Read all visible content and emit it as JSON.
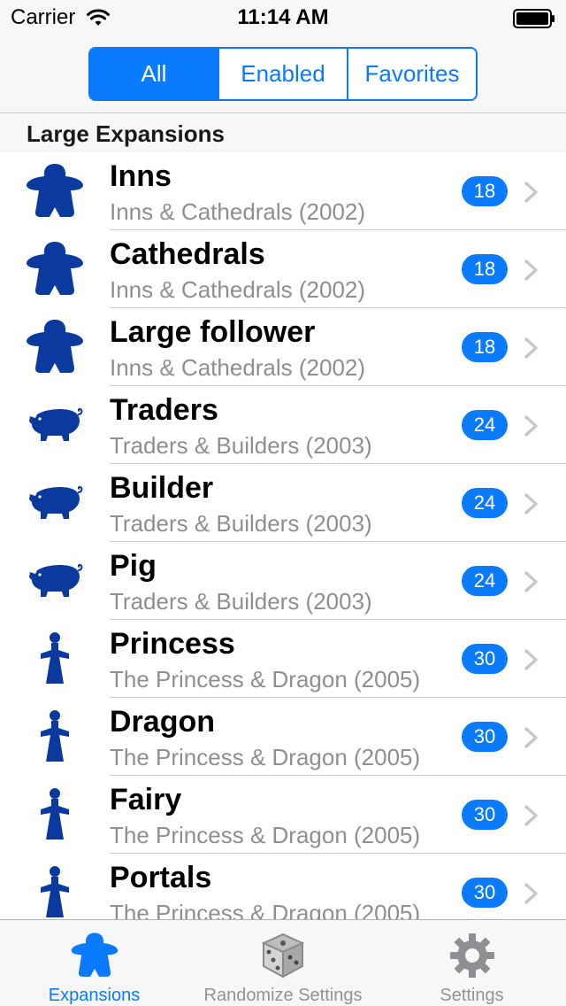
{
  "status_bar": {
    "carrier": "Carrier",
    "time": "11:14 AM"
  },
  "segments": [
    {
      "label": "All",
      "active": true
    },
    {
      "label": "Enabled",
      "active": false
    },
    {
      "label": "Favorites",
      "active": false
    }
  ],
  "section": {
    "title": "Large Expansions"
  },
  "rows": [
    {
      "title": "Inns",
      "subtitle": "Inns & Cathedrals (2002)",
      "count": "18",
      "icon": "meeple-icon"
    },
    {
      "title": "Cathedrals",
      "subtitle": "Inns & Cathedrals (2002)",
      "count": "18",
      "icon": "meeple-icon"
    },
    {
      "title": "Large follower",
      "subtitle": "Inns & Cathedrals (2002)",
      "count": "18",
      "icon": "meeple-icon"
    },
    {
      "title": "Traders",
      "subtitle": "Traders & Builders (2003)",
      "count": "24",
      "icon": "pig-icon"
    },
    {
      "title": "Builder",
      "subtitle": "Traders & Builders (2003)",
      "count": "24",
      "icon": "pig-icon"
    },
    {
      "title": "Pig",
      "subtitle": "Traders & Builders (2003)",
      "count": "24",
      "icon": "pig-icon"
    },
    {
      "title": "Princess",
      "subtitle": "The Princess & Dragon (2005)",
      "count": "30",
      "icon": "princess-icon"
    },
    {
      "title": "Dragon",
      "subtitle": "The Princess & Dragon (2005)",
      "count": "30",
      "icon": "princess-icon"
    },
    {
      "title": "Fairy",
      "subtitle": "The Princess & Dragon (2005)",
      "count": "30",
      "icon": "princess-icon"
    },
    {
      "title": "Portals",
      "subtitle": "The Princess & Dragon (2005)",
      "count": "30",
      "icon": "princess-icon"
    }
  ],
  "tabs": [
    {
      "label": "Expansions",
      "icon": "meeple-icon",
      "active": true
    },
    {
      "label": "Randomize Settings",
      "icon": "dice-icon",
      "active": false
    },
    {
      "label": "Settings",
      "icon": "gear-icon",
      "active": false
    }
  ],
  "colors": {
    "accent": "#0a7aff",
    "icon_blue": "#0b3a9e",
    "subtitle_gray": "#8e8e93"
  }
}
